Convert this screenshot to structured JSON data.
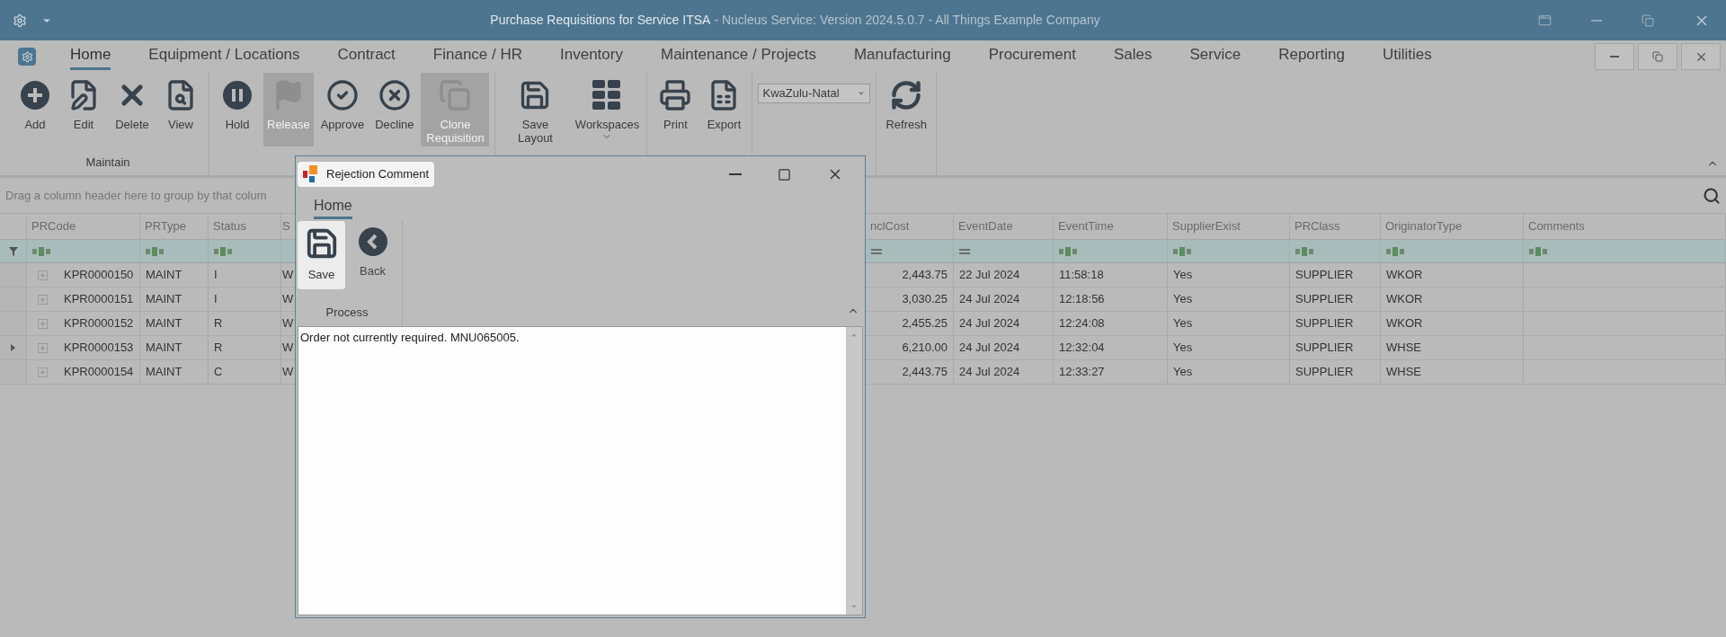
{
  "title_bar": {
    "title": "Purchase Requisitions for Service ITSA",
    "subtitle": "- Nucleus Service: Version 2024.5.0.7 - All Things Example Company"
  },
  "tabs": [
    {
      "label": "Home",
      "selected": true
    },
    {
      "label": "Equipment / Locations",
      "selected": false
    },
    {
      "label": "Contract",
      "selected": false
    },
    {
      "label": "Finance / HR",
      "selected": false
    },
    {
      "label": "Inventory",
      "selected": false
    },
    {
      "label": "Maintenance / Projects",
      "selected": false
    },
    {
      "label": "Manufacturing",
      "selected": false
    },
    {
      "label": "Procurement",
      "selected": false
    },
    {
      "label": "Sales",
      "selected": false
    },
    {
      "label": "Service",
      "selected": false
    },
    {
      "label": "Reporting",
      "selected": false
    },
    {
      "label": "Utilities",
      "selected": false
    }
  ],
  "ribbon": {
    "groups": [
      {
        "label": "Maintain",
        "items": [
          {
            "kind": "button",
            "label": "Add",
            "disabled": false
          },
          {
            "kind": "button",
            "label": "Edit",
            "disabled": false
          },
          {
            "kind": "button",
            "label": "Delete",
            "disabled": false
          },
          {
            "kind": "button",
            "label": "View",
            "disabled": false
          }
        ]
      },
      {
        "items": [
          {
            "kind": "button",
            "label": "Hold",
            "disabled": false
          },
          {
            "kind": "button",
            "label": "Release",
            "disabled": true
          },
          {
            "kind": "button",
            "label": "Approve",
            "disabled": false
          },
          {
            "kind": "button",
            "label": "Decline",
            "disabled": false
          },
          {
            "kind": "button",
            "label": "Clone Requisition",
            "disabled": true
          }
        ]
      },
      {
        "items": [
          {
            "kind": "button",
            "label": "Save Layout",
            "disabled": false
          },
          {
            "kind": "button",
            "label": "Workspaces",
            "disabled": false,
            "has_menu": true
          }
        ]
      },
      {
        "items": [
          {
            "kind": "button",
            "label": "Print",
            "disabled": false
          },
          {
            "kind": "button",
            "label": "Export",
            "disabled": false
          }
        ]
      },
      {
        "items": [
          {
            "kind": "dropdown",
            "value": "KwaZulu-Natal"
          }
        ]
      },
      {
        "items": [
          {
            "kind": "button",
            "label": "Refresh",
            "disabled": false
          }
        ]
      }
    ]
  },
  "grid": {
    "group_panel_hint": "Drag a column header here to group by that colum",
    "columns": [
      {
        "label": "PRCode",
        "kind": "code",
        "filter": {
          "kind": "text"
        }
      },
      {
        "label": "PRType",
        "kind": "text",
        "filter": {
          "kind": "text"
        }
      },
      {
        "label": "Status",
        "kind": "text",
        "filter": {
          "kind": "text"
        }
      },
      {
        "label": "S",
        "kind": "cut"
      },
      {
        "label": "nclCost",
        "kind": "number",
        "filter": {
          "kind": "equals"
        }
      },
      {
        "label": "EventDate",
        "kind": "text",
        "filter": {
          "kind": "equals"
        }
      },
      {
        "label": "EventTime",
        "kind": "text",
        "filter": {
          "kind": "text"
        }
      },
      {
        "label": "SupplierExist",
        "kind": "text",
        "filter": {
          "kind": "text"
        }
      },
      {
        "label": "PRClass",
        "kind": "text",
        "filter": {
          "kind": "text"
        }
      },
      {
        "label": "OriginatorType",
        "kind": "text",
        "filter": {
          "kind": "text"
        }
      },
      {
        "label": "Comments",
        "kind": "text",
        "filter": {
          "kind": "text"
        }
      }
    ],
    "rows": [
      {
        "selected": false,
        "cells": [
          "KPR0000150",
          "MAINT",
          "I",
          "W",
          "2,443.75",
          "22 Jul 2024",
          "11:58:18",
          "Yes",
          "SUPPLIER",
          "WKOR"
        ]
      },
      {
        "selected": false,
        "cells": [
          "KPR0000151",
          "MAINT",
          "I",
          "W",
          "3,030.25",
          "24 Jul 2024",
          "12:18:56",
          "Yes",
          "SUPPLIER",
          "WKOR"
        ]
      },
      {
        "selected": false,
        "cells": [
          "KPR0000152",
          "MAINT",
          "R",
          "W",
          "2,455.25",
          "24 Jul 2024",
          "12:24:08",
          "Yes",
          "SUPPLIER",
          "WKOR"
        ]
      },
      {
        "selected": true,
        "cells": [
          "KPR0000153",
          "MAINT",
          "R",
          "W",
          "6,210.00",
          "24 Jul 2024",
          "12:32:04",
          "Yes",
          "SUPPLIER",
          "WHSE"
        ]
      },
      {
        "selected": false,
        "cells": [
          "KPR0000154",
          "MAINT",
          "C",
          "W",
          "2,443.75",
          "24 Jul 2024",
          "12:33:27",
          "Yes",
          "SUPPLIER",
          "WHSE"
        ]
      }
    ]
  },
  "dialog": {
    "title": "Rejection Comment",
    "tabs": [
      {
        "label": "Home",
        "selected": true
      }
    ],
    "group_label": "Process",
    "buttons": [
      {
        "label": "Save",
        "selected": true
      },
      {
        "label": "Back",
        "selected": false
      }
    ],
    "comment": "Order not currently required. MNU065005."
  }
}
